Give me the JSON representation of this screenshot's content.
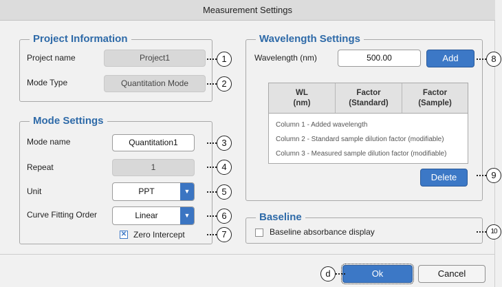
{
  "window": {
    "title": "Measurement Settings"
  },
  "project": {
    "legend": "Project Information",
    "name_label": "Project name",
    "name_value": "Project1",
    "mode_type_label": "Mode Type",
    "mode_type_value": "Quantitation Mode"
  },
  "mode": {
    "legend": "Mode Settings",
    "name_label": "Mode name",
    "name_value": "Quantitation1",
    "repeat_label": "Repeat",
    "repeat_value": "1",
    "unit_label": "Unit",
    "unit_value": "PPT",
    "curve_label": "Curve Fitting Order",
    "curve_value": "Linear",
    "zero_intercept_label": "Zero Intercept",
    "zero_intercept_checked": true
  },
  "wavelength": {
    "legend": "Wavelength Settings",
    "label": "Wavelength (nm)",
    "value": "500.00",
    "add_label": "Add",
    "delete_label": "Delete",
    "columns": [
      {
        "line1": "WL",
        "line2": "(nm)"
      },
      {
        "line1": "Factor",
        "line2": "(Standard)"
      },
      {
        "line1": "Factor",
        "line2": "(Sample)"
      }
    ],
    "notes": [
      "Column 1 - Added wavelength",
      "Column 2 - Standard sample dilution factor (modifiable)",
      "Column 3 - Measured sample dilution factor (modifiable)"
    ]
  },
  "baseline": {
    "legend": "Baseline",
    "checkbox_label": "Baseline absorbance display",
    "checked": false
  },
  "footer": {
    "ok_label": "Ok",
    "cancel_label": "Cancel"
  },
  "callouts": {
    "c1": "1",
    "c2": "2",
    "c3": "3",
    "c4": "4",
    "c5": "5",
    "c6": "6",
    "c7": "7",
    "c8": "8",
    "c9": "9",
    "c10": "10",
    "cd": "d"
  },
  "icons": {
    "dropdown": "chevron-down-icon",
    "check": "checkmark-icon"
  }
}
